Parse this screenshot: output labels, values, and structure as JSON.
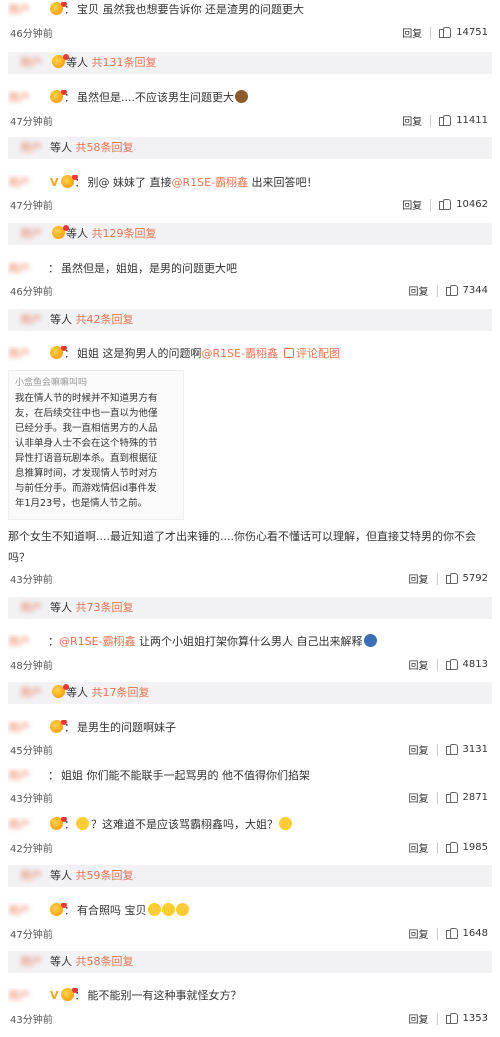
{
  "comments": [
    {
      "user": "用户",
      "text": "宝贝 虽然我也想要告诉你 还是渣男的问题更大",
      "time": "46分钟前",
      "likes": "14751",
      "reply_label": "回复"
    },
    {
      "user": "用户",
      "text": "虽然但是....不应该男生问题更大",
      "time": "47分钟前",
      "likes": "11411",
      "reply_label": "回复"
    },
    {
      "user": "用户",
      "vip": "V",
      "text_pre": "别@ 妹妹了 直接",
      "at": "@R1SE-霸栩鑫",
      "text_post": " 出来回答吧！",
      "time": "47分钟前",
      "likes": "10462",
      "reply_label": "回复"
    },
    {
      "user": "用户",
      "text": "虽然但是，姐姐，是男的问题更大吧",
      "time": "46分钟前",
      "likes": "7344",
      "reply_label": "回复"
    },
    {
      "user": "用户",
      "text_pre": "姐姐 这是狗男人的问题啊",
      "at": "@R1SE-霸栩鑫",
      "img_link": "评论配图",
      "text_cont": "那个女生不知道啊....最近知道了才出来锤的....你伤心看不懂话可以理解，但直接艾特男的你不会吗？",
      "time": "43分钟前",
      "likes": "5792",
      "reply_label": "回复"
    },
    {
      "user": "用户",
      "at": "@R1SE-霸栩鑫",
      "text_post": " 让两个小姐姐打架你算什么男人 自己出来解释",
      "time": "48分钟前",
      "likes": "4813",
      "reply_label": "回复"
    },
    {
      "user": "用户",
      "text": "是男生的问题啊妹子",
      "time": "45分钟前",
      "likes": "3131",
      "reply_label": "回复"
    },
    {
      "user": "用户",
      "text": "姐姐 你们能不能联手一起骂男的 他不值得你们掐架",
      "time": "43分钟前",
      "likes": "2871",
      "reply_label": "回复"
    },
    {
      "user": "用户",
      "text": "？这难道不是应该骂霸栩鑫吗，大姐？",
      "time": "42分钟前",
      "likes": "1985",
      "reply_label": "回复"
    },
    {
      "user": "用户",
      "text": "有合照吗 宝贝",
      "time": "47分钟前",
      "likes": "1648",
      "reply_label": "回复"
    },
    {
      "user": "用户",
      "vip": "V",
      "text": "能不能别一有这种事就怪女方？",
      "time": "43分钟前",
      "likes": "1353",
      "reply_label": "回复"
    }
  ],
  "sub_replies": [
    {
      "user": "用户",
      "label": "等人",
      "count": "共131条回复"
    },
    {
      "user": "用户",
      "label": "等人",
      "count": "共58条回复"
    },
    {
      "user": "用户",
      "label": "等人",
      "count": "共129条回复"
    },
    {
      "user": "用户",
      "label": "等人",
      "count": "共42条回复"
    },
    {
      "user": "用户",
      "label": "等人",
      "count": "共73条回复"
    },
    {
      "user": "用户",
      "label": "等人",
      "count": "共17条回复"
    },
    {
      "user": "用户",
      "label": "等人",
      "count": "共59条回复"
    },
    {
      "user": "用户",
      "label": "等人",
      "count": "共58条回复"
    }
  ],
  "image": {
    "header": "小盒鱼会嘛嘛叫吗",
    "lines": [
      "我在情人节的时候并不知道男方有",
      "友，在后续交往中也一直以为他僅",
      "已经分手。我一直相信男方的人品",
      "认非单身人士不会在这个特殊的节",
      "异性打语音玩剧本杀。直到根据征",
      "息推算时间，才发现情人节时对方",
      "与前任分手。而游戏情侣id事件发",
      "年1月23号，也是情人节之前。"
    ]
  },
  "colors": {
    "accent": "#eb7350",
    "vip": "#f5a623",
    "sub_bg": "#f2f2f5"
  }
}
